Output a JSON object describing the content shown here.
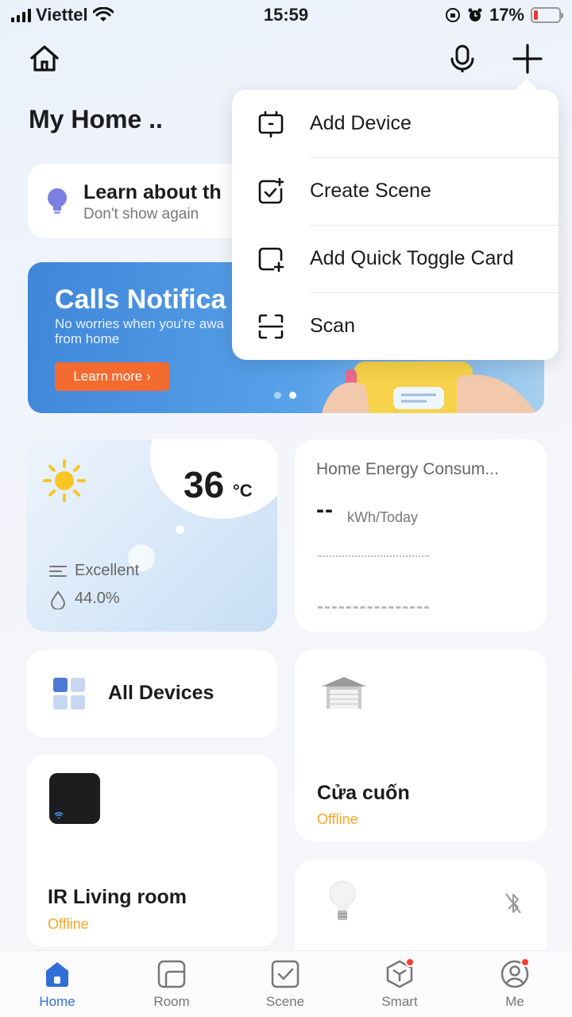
{
  "status_bar": {
    "carrier": "Viettel",
    "time": "15:59",
    "battery": "17%",
    "battery_level": 0.17
  },
  "header": {
    "title": "My Home ..",
    "icons": [
      "home-icon",
      "microphone-icon",
      "plus-icon"
    ]
  },
  "learn_card": {
    "title": "Learn about th",
    "subtitle": "Don't show again"
  },
  "banner": {
    "title": "Calls Notifica",
    "subtitle": "No worries when you're awa from home",
    "button": "Learn more ›",
    "active_dot": 2,
    "dot_count": 2
  },
  "weather": {
    "temperature": "36",
    "unit": "°C",
    "air_quality": "Excellent",
    "humidity": "44.0%"
  },
  "energy": {
    "title": "Home Energy Consum...",
    "value": "--",
    "unit": "kWh/Today"
  },
  "all_devices": {
    "label": "All Devices"
  },
  "devices": [
    {
      "name": "Cửa cuốn",
      "status": "Offline"
    },
    {
      "name": "IR Living room",
      "status": "Offline"
    }
  ],
  "menu": {
    "items": [
      {
        "label": "Add Device",
        "icon": "add-device-icon"
      },
      {
        "label": "Create Scene",
        "icon": "create-scene-icon"
      },
      {
        "label": "Add Quick Toggle Card",
        "icon": "add-card-icon"
      },
      {
        "label": "Scan",
        "icon": "scan-icon"
      }
    ]
  },
  "tabs": [
    {
      "label": "Home",
      "active": true
    },
    {
      "label": "Room"
    },
    {
      "label": "Scene"
    },
    {
      "label": "Smart",
      "badge": true
    },
    {
      "label": "Me",
      "badge": true
    }
  ],
  "colors": {
    "accent": "#2f6fd6",
    "offline": "#f5a623",
    "banner_button": "#f36b2f",
    "badge": "#ff3b30"
  }
}
